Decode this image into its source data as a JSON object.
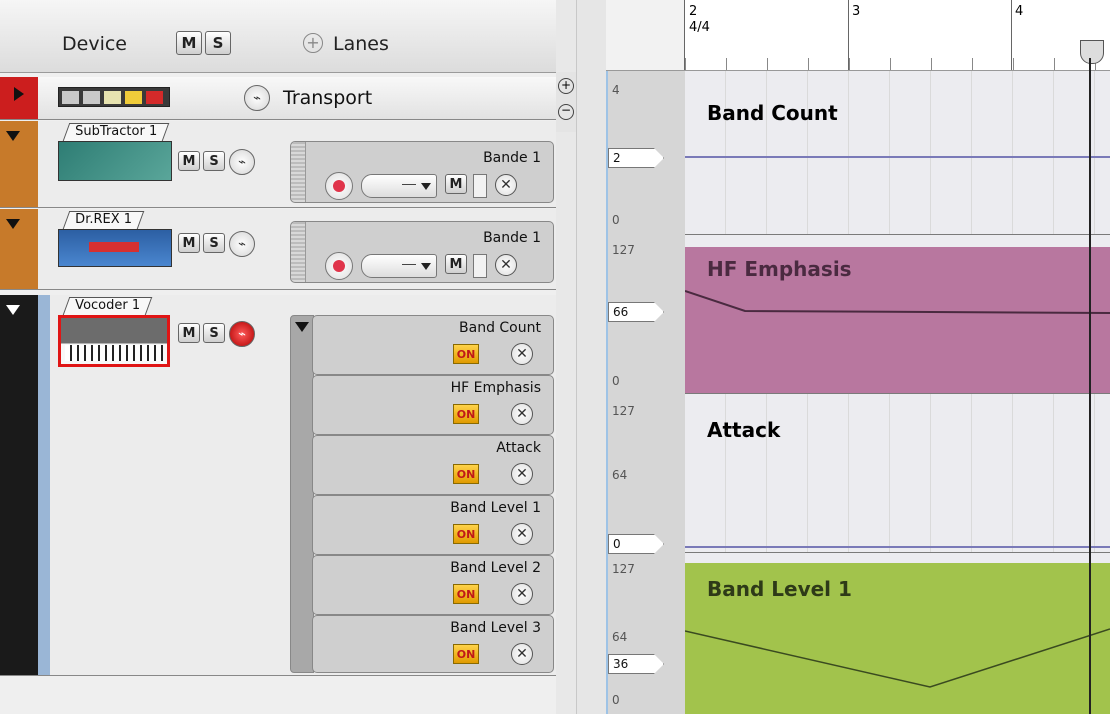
{
  "header": {
    "device_label": "Device",
    "mute_label": "M",
    "solo_label": "S",
    "add_icon": "plus-circle-icon",
    "lanes_label": "Lanes"
  },
  "ruler": {
    "bar2": "2",
    "time_sig": "4/4",
    "bar3": "3",
    "bar4": "4"
  },
  "zoom": {
    "in_icon": "zoom-in-icon",
    "out_icon": "zoom-out-icon"
  },
  "tracks": [
    {
      "name": "Transport",
      "type": "transport"
    },
    {
      "name": "SubTractor 1",
      "mute": "M",
      "solo": "S",
      "lane_label": "Bande 1",
      "lane_mute": "M",
      "color": "#c77a2a"
    },
    {
      "name": "Dr.REX 1",
      "mute": "M",
      "solo": "S",
      "lane_label": "Bande 1",
      "lane_mute": "M",
      "color": "#c77a2a"
    },
    {
      "name": "Vocoder 1",
      "mute": "M",
      "solo": "S",
      "color": "#9ab6d6",
      "params": [
        {
          "label": "Band Count",
          "on": "ON"
        },
        {
          "label": "HF Emphasis",
          "on": "ON"
        },
        {
          "label": "Attack",
          "on": "ON"
        },
        {
          "label": "Band Level 1",
          "on": "ON"
        },
        {
          "label": "Band Level 2",
          "on": "ON"
        },
        {
          "label": "Band Level 3",
          "on": "ON"
        }
      ]
    }
  ],
  "lanes": [
    {
      "title": "Band Count",
      "max": "4",
      "min": "0",
      "value": "2",
      "color": "#e8e8ee",
      "title_color": "#444"
    },
    {
      "title": "HF Emphasis",
      "max": "127",
      "min": "0",
      "value": "66",
      "color": "#b8779f",
      "title_color": "#4a2a40"
    },
    {
      "title": "Attack",
      "max": "127",
      "mid": "64",
      "min": "",
      "value": "0",
      "color": "#e8e8ee",
      "title_color": "#444"
    },
    {
      "title": "Band Level 1",
      "max": "127",
      "mid": "64",
      "min": "0",
      "value": "36",
      "color": "#a2c34c",
      "title_color": "#2e3a18"
    }
  ]
}
